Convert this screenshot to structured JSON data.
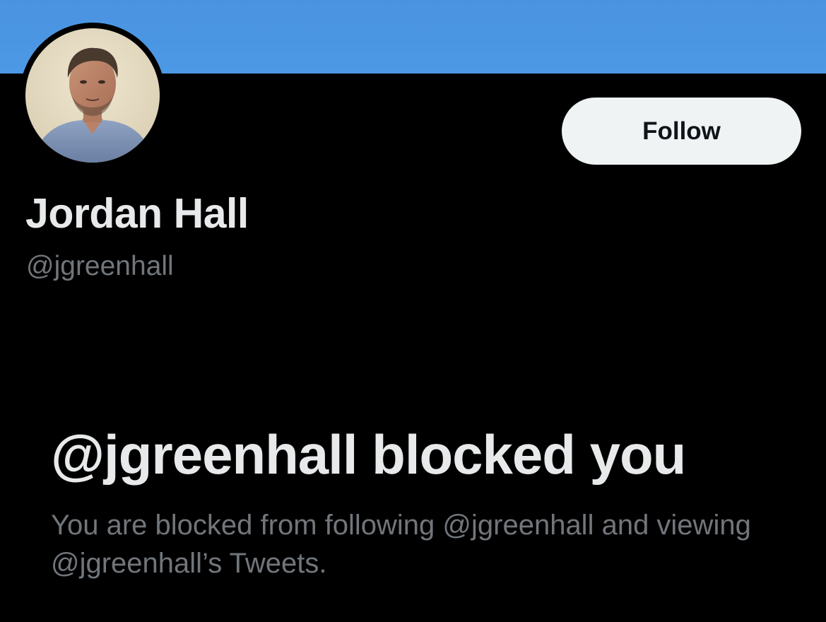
{
  "profile": {
    "display_name": "Jordan Hall",
    "handle": "@jgreenhall",
    "avatar": "profile-photo"
  },
  "actions": {
    "follow_label": "Follow"
  },
  "blocked_notice": {
    "title": "@jgreenhall blocked you",
    "description": "You are blocked from following @jgreenhall and viewing @jgreenhall’s Tweets."
  },
  "colors": {
    "banner": "#4c99e6",
    "background": "#000000",
    "primary_text": "#e7e9ea",
    "secondary_text": "#71767b",
    "button_bg": "#eff3f4",
    "button_text": "#0f1419"
  }
}
